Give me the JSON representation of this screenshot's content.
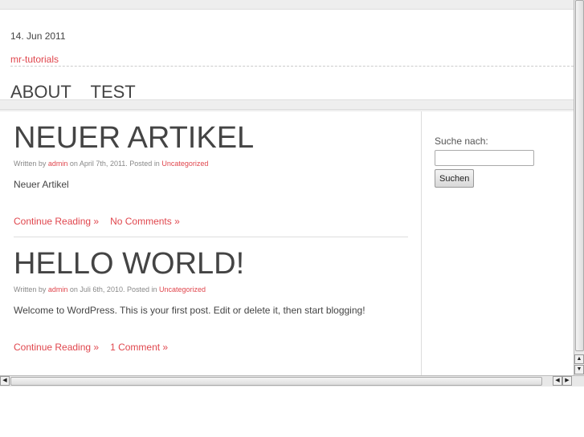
{
  "header": {
    "date": "14. Jun 2011",
    "site_name": "mr-tutorials",
    "nav": [
      "ABOUT",
      "TEST"
    ]
  },
  "posts": [
    {
      "title": "NEUER ARTIKEL",
      "written_by": "Written by",
      "author": "admin",
      "date_text": "on April 7th, 2011. Posted in",
      "category": "Uncategorized",
      "excerpt": "Neuer Artikel",
      "continue": "Continue Reading »",
      "comments": "No Comments »"
    },
    {
      "title": "HELLO WORLD!",
      "written_by": "Written by",
      "author": "admin",
      "date_text": "on Juli 6th, 2010. Posted in",
      "category": "Uncategorized",
      "excerpt": "Welcome to WordPress. This is your first post. Edit or delete it, then start blogging!",
      "continue": "Continue Reading »",
      "comments": "1 Comment »"
    }
  ],
  "sidebar": {
    "search_label": "Suche nach:",
    "search_value": "",
    "search_button": "Suchen"
  },
  "scrollbar": {
    "arrow_up": "▲",
    "arrow_down": "▼",
    "arrow_left": "◀",
    "arrow_right": "▶"
  }
}
